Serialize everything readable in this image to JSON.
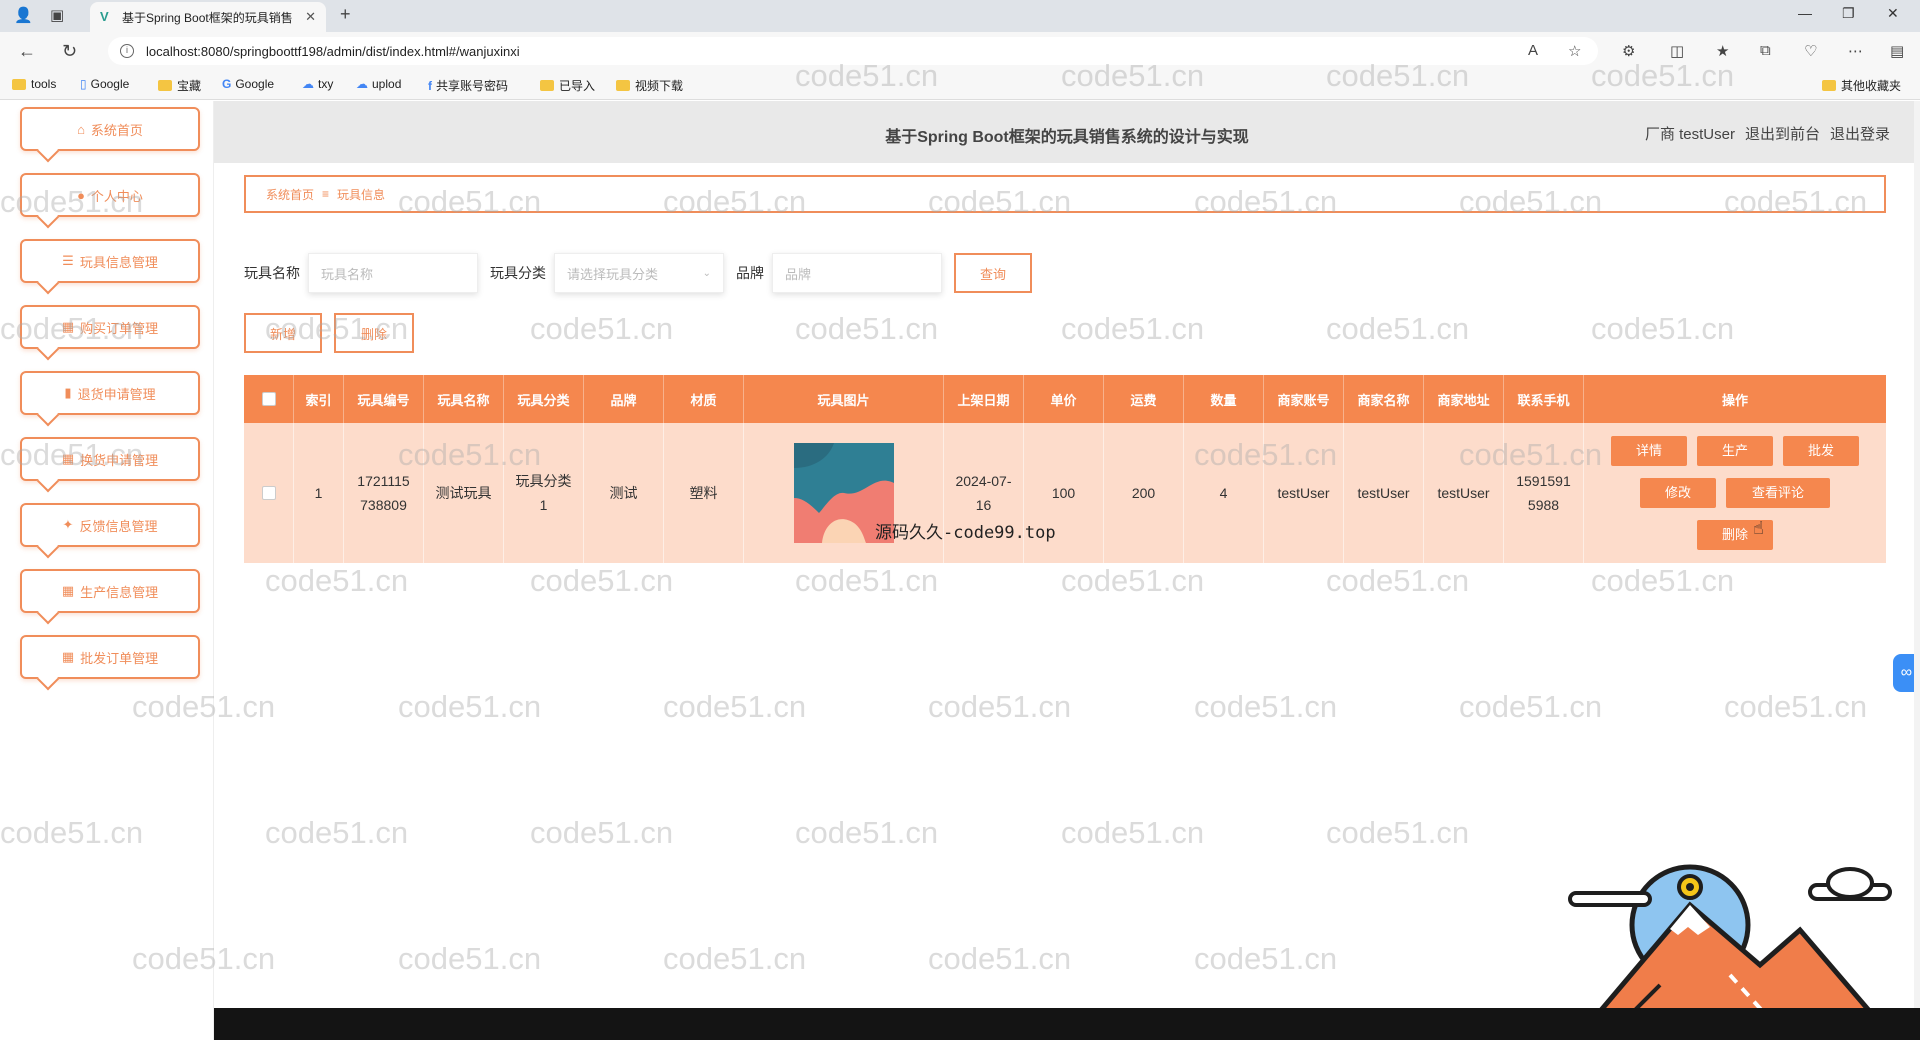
{
  "browser": {
    "tab_title": "基于Spring Boot框架的玩具销售",
    "url": "localhost:8080/springboottf198/admin/dist/index.html#/wanjuxinxi",
    "bookmarks": [
      "tools",
      "Google",
      "宝藏",
      "Google",
      "txy",
      "uplod",
      "共享账号密码",
      "已导入",
      "视频下载"
    ],
    "other_bookmarks": "其他收藏夹"
  },
  "header": {
    "title": "基于Spring Boot框架的玩具销售系统的设计与实现",
    "user": "厂商 testUser",
    "back_to_front": "退出到前台",
    "logout": "退出登录"
  },
  "sidebar": {
    "items": [
      {
        "label": "系统首页",
        "icon": "home-icon"
      },
      {
        "label": "个人中心",
        "icon": "user-icon"
      },
      {
        "label": "玩具信息管理",
        "icon": "list-icon"
      },
      {
        "label": "购买订单管理",
        "icon": "grid-icon"
      },
      {
        "label": "退货申请管理",
        "icon": "chart-icon"
      },
      {
        "label": "换货申请管理",
        "icon": "grid-icon"
      },
      {
        "label": "反馈信息管理",
        "icon": "thumb-icon"
      },
      {
        "label": "生产信息管理",
        "icon": "grid-icon"
      },
      {
        "label": "批发订单管理",
        "icon": "grid-icon"
      }
    ]
  },
  "breadcrumb": {
    "home": "系统首页",
    "separator": "≡",
    "current": "玩具信息"
  },
  "search": {
    "name_label": "玩具名称",
    "name_placeholder": "玩具名称",
    "category_label": "玩具分类",
    "category_placeholder": "请选择玩具分类",
    "brand_label": "品牌",
    "brand_placeholder": "品牌",
    "query_button": "查询"
  },
  "actions": {
    "add": "新增",
    "delete": "删除"
  },
  "table": {
    "headers": [
      "索引",
      "玩具编号",
      "玩具名称",
      "玩具分类",
      "品牌",
      "材质",
      "玩具图片",
      "上架日期",
      "单价",
      "运费",
      "数量",
      "商家账号",
      "商家名称",
      "商家地址",
      "联系手机",
      "操作"
    ],
    "row": {
      "index": "1",
      "number_line1": "1721115",
      "number_line2": "738809",
      "name": "测试玩具",
      "category_line1": "玩具分类",
      "category_line2": "1",
      "brand": "测试",
      "material": "塑料",
      "date_line1": "2024-07-",
      "date_line2": "16",
      "price": "100",
      "shipping": "200",
      "quantity": "4",
      "merchant_account": "testUser",
      "merchant_name": "testUser",
      "merchant_address": "testUser",
      "phone_line1": "1591591",
      "phone_line2": "5988"
    },
    "ops": {
      "detail": "详情",
      "produce": "生产",
      "wholesale": "批发",
      "edit": "修改",
      "reviews": "查看评论",
      "delete": "删除"
    }
  },
  "overlay_caption": "源码久久-code99.top",
  "watermark": "code51.cn",
  "colors": {
    "accent": "#f5874e",
    "row_bg": "#fddccb",
    "topbar": "#e9e9e9"
  }
}
